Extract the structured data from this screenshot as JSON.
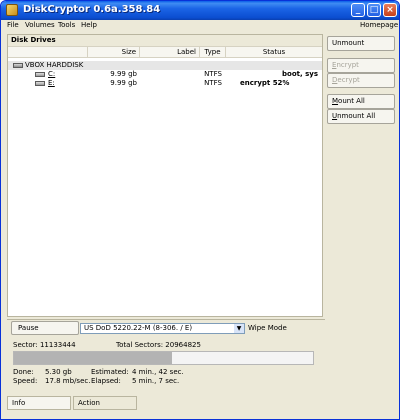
{
  "window": {
    "title": "DiskCryptor 0.6a.358.84"
  },
  "menu": {
    "file": "File",
    "volumes": "Volumes",
    "tools": "Tools",
    "help": "Help",
    "homepage": "Homepage"
  },
  "disk_panel": {
    "caption": "Disk Drives",
    "columns": {
      "size": "Size",
      "label": "Label",
      "type": "Type",
      "status": "Status"
    },
    "hdd": {
      "name": "VBOX HARDDISK"
    },
    "volumes": [
      {
        "name": "C:",
        "size": "9.99 gb",
        "label": "",
        "type": "NTFS",
        "status": "boot, sys"
      },
      {
        "name": "E:",
        "size": "9.99 gb",
        "label": "",
        "type": "NTFS",
        "status": "encrypt 52%"
      }
    ]
  },
  "buttons": {
    "unmount": "Unmount",
    "encrypt_first": "E",
    "encrypt_rest": "ncrypt",
    "decrypt_first": "D",
    "decrypt_rest": "ecrypt",
    "mount_all_first": "M",
    "mount_all_rest": "ount All",
    "unmount_all_first": "U",
    "unmount_all_rest": "nmount All"
  },
  "progress": {
    "pause": "Pause",
    "wipe_mode_value": "US DoD 5220.22-M (8-306. / E)",
    "wipe_mode_label": "Wipe Mode",
    "sector": "Sector: 11133444",
    "total_sectors": "Total Sectors: 20964825",
    "fraction": 0.53,
    "done_label": "Done:",
    "done_value": "5.30 gb",
    "speed_label": "Speed:",
    "speed_value": "17.8 mb/sec.",
    "estimated_label": "Estimated:",
    "estimated_value": "4 min., 42 sec.",
    "elapsed_label": "Elapsed:",
    "elapsed_value": "5 min., 7 sec."
  },
  "tabs": {
    "info": "Info",
    "action": "Action"
  },
  "colors": {
    "titlebar": "#0b4dd0",
    "progress_fill": "#b3b3b3",
    "window_bg": "#ece9d8"
  }
}
